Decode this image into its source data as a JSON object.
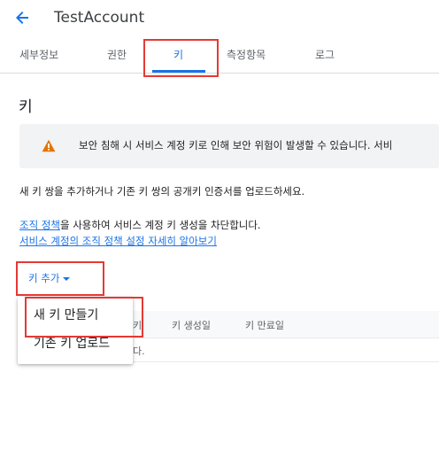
{
  "header": {
    "title": "TestAccount"
  },
  "tabs": [
    {
      "label": "세부정보"
    },
    {
      "label": "권한"
    },
    {
      "label": "키"
    },
    {
      "label": "측정항목"
    },
    {
      "label": "로그"
    }
  ],
  "section": {
    "heading": "키"
  },
  "banner": {
    "icon": "warning-icon",
    "text": "보안 침해 시 서비스 계정 키로 인해 보안 위험이 발생할 수 있습니다. 서비"
  },
  "description": "새 키 쌍을 추가하거나 기존 키 쌍의 공개키 인증서를 업로드하세요.",
  "policy": {
    "link_text": "조직 정책",
    "rest_text": "을 사용하여 서비스 계정 키 생성을 차단합니다.",
    "learn_more": "서비스 계정의 조직 정책 설정 자세히 알아보기"
  },
  "add_key_button": {
    "label": "키 추가"
  },
  "menu": {
    "items": [
      {
        "label": "새 키 만들기"
      },
      {
        "label": "기존 키 업로드"
      }
    ]
  },
  "table": {
    "columns": [
      "키",
      "키 생성일",
      "키 만료일"
    ],
    "empty_fragment": "다."
  },
  "colors": {
    "accent": "#1a73e8",
    "warning": "#e37400",
    "annotation": "#e53935"
  }
}
